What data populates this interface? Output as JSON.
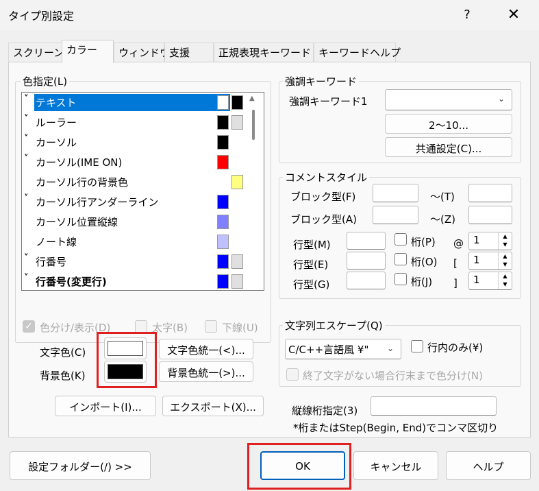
{
  "window": {
    "title": "タイプ別設定",
    "help": "?",
    "close": "✕"
  },
  "tabs": [
    "スクリーン",
    "カラー",
    "ウィンドウ",
    "支援",
    "正規表現キーワード",
    "キーワードヘルプ"
  ],
  "color_group": {
    "label": "色指定(L)",
    "items": [
      {
        "label": "テキスト",
        "chev": true,
        "selected": true,
        "fg": "#ffffff",
        "bg": "#000000",
        "bold": false
      },
      {
        "label": "ルーラー",
        "chev": true,
        "selected": false,
        "fg": "#000000",
        "bg": "#e0e0e0",
        "bold": false
      },
      {
        "label": "カーソル",
        "chev": true,
        "selected": false,
        "fg": "#000000",
        "bg": null,
        "bold": false
      },
      {
        "label": "カーソル(IME ON)",
        "chev": true,
        "selected": false,
        "fg": "#ff0000",
        "bg": null,
        "bold": false
      },
      {
        "label": "カーソル行の背景色",
        "chev": false,
        "selected": false,
        "fg": null,
        "bg": "#ffff80",
        "bold": false
      },
      {
        "label": "カーソル行アンダーライン",
        "chev": true,
        "selected": false,
        "fg": "#0000ff",
        "bg": null,
        "bold": false
      },
      {
        "label": "カーソル位置縦線",
        "chev": false,
        "selected": false,
        "fg": "#8080ff",
        "bg": null,
        "bold": false
      },
      {
        "label": "ノート線",
        "chev": false,
        "selected": false,
        "fg": "#c0c0ff",
        "bg": null,
        "bold": false
      },
      {
        "label": "行番号",
        "chev": true,
        "selected": false,
        "fg": "#0000ff",
        "bg": "#e0e0e0",
        "bold": false
      },
      {
        "label": "行番号(変更行)",
        "chev": true,
        "selected": false,
        "fg": "#0000ff",
        "bg": "#e0e0e0",
        "bold": true
      }
    ],
    "display_check": "色分け/表示(D)",
    "bold_check": "太字(B)",
    "underline_check": "下線(U)",
    "text_color_label": "文字色(C)",
    "bg_color_label": "背景色(K)",
    "text_color": "#ffffff",
    "bg_color": "#000000",
    "unify_text": "文字色統一(<)...",
    "unify_bg": "背景色統一(>)..."
  },
  "import_btn": "インポート(I)...",
  "export_btn": "エクスポート(X)...",
  "emphasis": {
    "label": "強調キーワード",
    "kw1_label": "強調キーワード1",
    "kw1_value": "",
    "range_btn": "2〜10...",
    "common_btn": "共通設定(C)..."
  },
  "comment": {
    "label": "コメントスタイル",
    "block1": "ブロック型(F)",
    "to1": "〜(T)",
    "block2": "ブロック型(A)",
    "to2": "〜(Z)",
    "lines": [
      {
        "label": "行型(M)",
        "col": "桁(P)",
        "mark": "@",
        "value": "1"
      },
      {
        "label": "行型(E)",
        "col": "桁(O)",
        "mark": "[",
        "value": "1"
      },
      {
        "label": "行型(G)",
        "col": "桁(J)",
        "mark": "]",
        "value": "1"
      }
    ]
  },
  "escape": {
    "label": "文字列エスケープ(Q)",
    "value": "C/C++言語風 ¥\"",
    "inline_only": "行内のみ(¥)",
    "end_color": "終了文字がない場合行末まで色分け(N)"
  },
  "vline": {
    "label": "縦線桁指定(3)",
    "value": "",
    "hint": "*桁またはStep(Begin, End)でコンマ区切り"
  },
  "footer": {
    "folder": "設定フォルダー(/) >>",
    "ok": "OK",
    "cancel": "キャンセル",
    "help": "ヘルプ"
  }
}
